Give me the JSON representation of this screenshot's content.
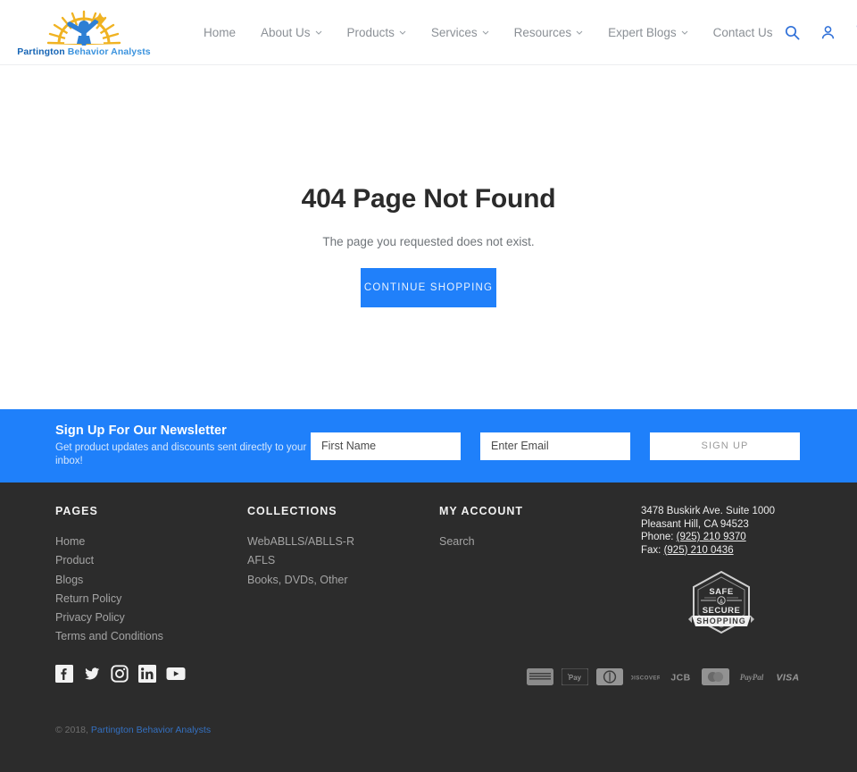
{
  "header": {
    "logo": {
      "brand_part1": "Partington",
      "brand_part2": "Behavior Analysts",
      "alt": "partington-behavior-analysts-logo"
    },
    "nav": [
      {
        "label": "Home",
        "has_caret": false
      },
      {
        "label": "About Us",
        "has_caret": true
      },
      {
        "label": "Products",
        "has_caret": true
      },
      {
        "label": "Services",
        "has_caret": true
      },
      {
        "label": "Resources",
        "has_caret": true
      },
      {
        "label": "Expert Blogs",
        "has_caret": true
      },
      {
        "label": "Contact Us",
        "has_caret": false
      }
    ],
    "icons": [
      {
        "name": "search-icon"
      },
      {
        "name": "account-icon"
      },
      {
        "name": "cart-icon"
      }
    ],
    "accent_color": "#2e6fd8"
  },
  "main": {
    "title": "404 Page Not Found",
    "subtitle": "The page you requested does not exist.",
    "cta_label": "CONTINUE SHOPPING",
    "cta_color": "#2080fa"
  },
  "newsletter": {
    "title": "Sign Up For Our Newsletter",
    "subtitle": "Get product updates and discounts sent directly to your inbox!",
    "first_name_placeholder": "First Name",
    "email_placeholder": "Enter Email",
    "first_name_value": "",
    "email_value": "",
    "submit_label": "SIGN UP",
    "background_color": "#1f80fa"
  },
  "footer": {
    "background_color": "#2c2c2c",
    "columns": [
      {
        "heading": "PAGES",
        "links": [
          "Home",
          "Product",
          "Blogs",
          "Return Policy",
          "Privacy Policy",
          "Terms and Conditions"
        ]
      },
      {
        "heading": "COLLECTIONS",
        "links": [
          "WebABLLS/ABLLS-R",
          "AFLS",
          "Books, DVDs, Other"
        ]
      },
      {
        "heading": "MY ACCOUNT",
        "links": [
          "Search"
        ]
      }
    ],
    "contact": {
      "address_line1": "3478 Buskirk Ave. Suite 1000",
      "address_line2": "Pleasant Hill, CA 94523",
      "phone_label": "Phone:",
      "phone": "(925) 210 9370",
      "fax_label": "Fax:",
      "fax": "(925) 210 0436"
    },
    "trust_badge": {
      "name": "safe-secure-shopping-badge",
      "line1": "SAFE",
      "amp": "&",
      "line2": "SECURE",
      "ribbon": "SHOPPING"
    },
    "social": [
      {
        "name": "facebook-icon",
        "label": "Facebook"
      },
      {
        "name": "twitter-icon",
        "label": "Twitter"
      },
      {
        "name": "instagram-icon",
        "label": "Instagram"
      },
      {
        "name": "linkedin-icon",
        "label": "LinkedIn"
      },
      {
        "name": "youtube-icon",
        "label": "YouTube"
      }
    ],
    "payments": [
      {
        "name": "american-express-icon",
        "label": "American Express"
      },
      {
        "name": "apple-pay-icon",
        "label": "Apple Pay"
      },
      {
        "name": "diners-club-icon",
        "label": "Diners Club"
      },
      {
        "name": "discover-icon",
        "label": "Discover"
      },
      {
        "name": "jcb-icon",
        "label": "JCB"
      },
      {
        "name": "mastercard-icon",
        "label": "Mastercard"
      },
      {
        "name": "paypal-icon",
        "label": "PayPal"
      },
      {
        "name": "visa-icon",
        "label": "Visa"
      }
    ],
    "copyright_prefix": "© 2018,",
    "copyright_link": "Partington Behavior Analysts",
    "copyright_link_color": "#3470c0"
  }
}
